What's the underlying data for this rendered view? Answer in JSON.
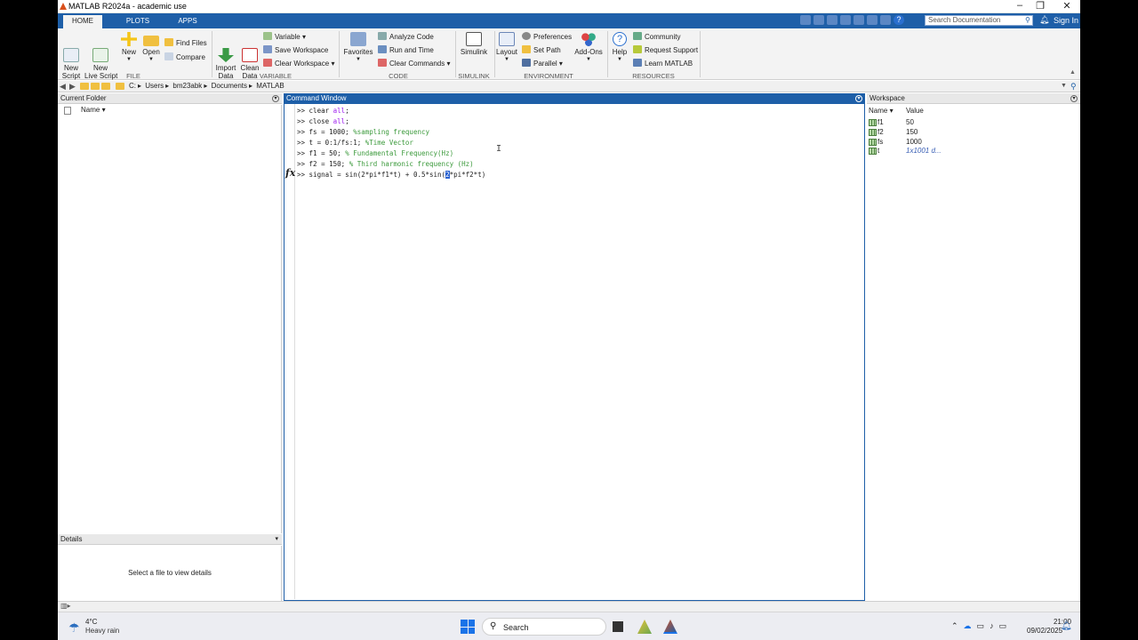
{
  "window": {
    "title": "MATLAB R2024a - academic use",
    "controls": [
      "–",
      "❐",
      "✕"
    ]
  },
  "tabs": [
    {
      "label": "HOME",
      "active": true
    },
    {
      "label": "PLOTS",
      "active": false
    },
    {
      "label": "APPS",
      "active": false
    }
  ],
  "topbar": {
    "search_placeholder": "Search Documentation",
    "signin": "Sign In"
  },
  "ribbon": {
    "file": {
      "group": "FILE",
      "new_script": "New\nScript",
      "new_live_script": "New\nLive Script",
      "new": "New",
      "open": "Open",
      "find_files": "Find Files",
      "compare": "Compare"
    },
    "variable": {
      "group": "VARIABLE",
      "import_data": "Import\nData",
      "clean_data": "Clean\nData",
      "variable": "Variable",
      "save_workspace": "Save Workspace",
      "clear_workspace": "Clear Workspace"
    },
    "code": {
      "group": "CODE",
      "favorites": "Favorites",
      "analyze_code": "Analyze Code",
      "run_and_time": "Run and Time",
      "clear_commands": "Clear Commands"
    },
    "simulink": {
      "group": "SIMULINK",
      "simulink": "Simulink"
    },
    "environment": {
      "group": "ENVIRONMENT",
      "layout": "Layout",
      "preferences": "Preferences",
      "set_path": "Set Path",
      "parallel": "Parallel",
      "addons": "Add-Ons"
    },
    "resources": {
      "group": "RESOURCES",
      "help": "Help",
      "community": "Community",
      "request_support": "Request Support",
      "learn_matlab": "Learn MATLAB"
    }
  },
  "path": [
    "C:",
    "Users",
    "bm23abk",
    "Documents",
    "MATLAB"
  ],
  "current_folder": {
    "title": "Current Folder",
    "col_name": "Name"
  },
  "details": {
    "title": "Details",
    "message": "Select a file to view details"
  },
  "command_window": {
    "title": "Command Window",
    "prompt": ">>",
    "fx": "fx",
    "lines": [
      {
        "code": "clear ",
        "kw": "all",
        "tail": ";",
        "comment": ""
      },
      {
        "code": "close ",
        "kw": "all",
        "tail": ";",
        "comment": ""
      },
      {
        "code": "fs = 1000; ",
        "kw": "",
        "tail": "",
        "comment": "%sampling frequency"
      },
      {
        "code": "t = 0:1/fs:1; ",
        "kw": "",
        "tail": "",
        "comment": "%Time Vector"
      },
      {
        "code": "f1 = 50; ",
        "kw": "",
        "tail": "",
        "comment": "% Fundamental Frequency(Hz)"
      },
      {
        "code": "f2 = 150; ",
        "kw": "",
        "tail": "",
        "comment": "% Third harmonic frequency (Hz)"
      }
    ],
    "current_pre": "signal = sin(2*pi*f1*t) + 0.5*sin(",
    "current_cursor": "2",
    "current_post": "*pi*f2*t)"
  },
  "workspace": {
    "title": "Workspace",
    "col_name": "Name",
    "col_value": "Value",
    "rows": [
      {
        "name": "f1",
        "value": "50"
      },
      {
        "name": "f2",
        "value": "150"
      },
      {
        "name": "fs",
        "value": "1000"
      },
      {
        "name": "t",
        "value": "1x1001 d..."
      }
    ]
  },
  "taskbar": {
    "temp": "4°C",
    "weather": "Heavy rain",
    "search": "Search",
    "time": "21:00",
    "date": "09/02/2025"
  },
  "colors": {
    "accent": "#1e5fa8",
    "comment": "#3c9a3c",
    "keyword": "#a020f0"
  }
}
